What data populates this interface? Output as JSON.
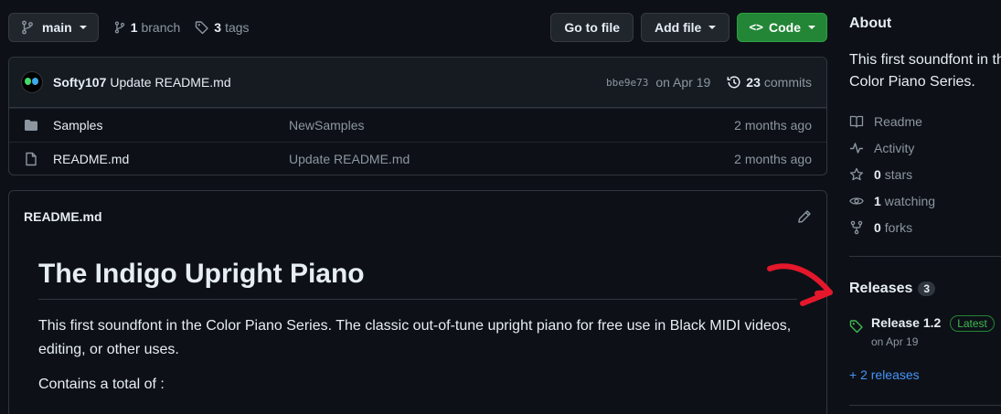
{
  "toolbar": {
    "branch_label": "main",
    "branch_count": "1",
    "branch_word": "branch",
    "tag_count": "3",
    "tag_word": "tags",
    "go_to_file": "Go to file",
    "add_file": "Add file",
    "code": "Code",
    "code_glyph": "<>"
  },
  "commit": {
    "author": "Softy107",
    "message": "Update README.md",
    "sha": "bbe9e73",
    "date": "on Apr 19",
    "commit_count": "23",
    "commit_word": "commits"
  },
  "files": [
    {
      "name": "Samples",
      "message": "NewSamples",
      "age": "2 months ago",
      "icon": "folder-icon"
    },
    {
      "name": "README.md",
      "message": "Update README.md",
      "age": "2 months ago",
      "icon": "file-icon"
    }
  ],
  "readme": {
    "filename": "README.md",
    "heading": "The Indigo Upright Piano",
    "paragraph": "This first soundfont in the Color Piano Series. The classic out-of-tune upright piano for free use in Black MIDI videos, editing, or other uses.",
    "contains": "Contains a total of :"
  },
  "sidebar": {
    "about_title": "About",
    "about_desc": "This first soundfont in the Color Piano Series.",
    "readme_link": "Readme",
    "activity_link": "Activity",
    "stars_count": "0",
    "stars_word": "stars",
    "watching_count": "1",
    "watching_word": "watching",
    "forks_count": "0",
    "forks_word": "forks",
    "releases_title": "Releases",
    "releases_count": "3",
    "release_name": "Release 1.2",
    "latest_label": "Latest",
    "release_date": "on Apr 19",
    "more_releases": "+ 2 releases"
  },
  "colors": {
    "background": "#0d1117",
    "border": "#30363d",
    "code_button": "#238636",
    "link": "#4493f8",
    "annotation_arrow": "#e5172b"
  }
}
